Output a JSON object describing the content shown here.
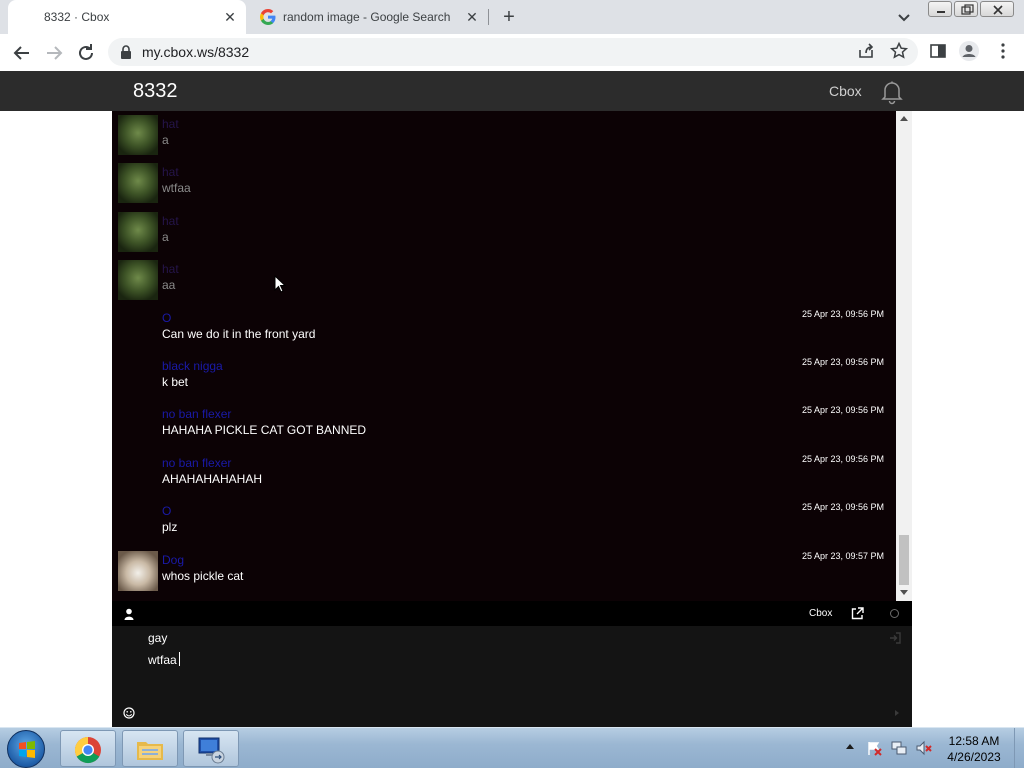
{
  "browser": {
    "tabs": [
      {
        "title": "8332 · Cbox",
        "active": true
      },
      {
        "title": "random image - Google Search",
        "active": false
      }
    ],
    "url": "my.cbox.ws/8332"
  },
  "page": {
    "title": "8332",
    "brand": "Cbox",
    "accent_name_color": "#1a1aa8",
    "chat_background": "#0c0205"
  },
  "messages": [
    {
      "name": "hat",
      "text": "a",
      "time": "",
      "avatar": "alien",
      "dim": true
    },
    {
      "name": "hat",
      "text": "wtfaa",
      "time": "",
      "avatar": "alien",
      "dim": true
    },
    {
      "name": "hat",
      "text": "a",
      "time": "",
      "avatar": "alien",
      "dim": true
    },
    {
      "name": "hat",
      "text": "aa",
      "time": "",
      "avatar": "alien",
      "dim": true
    },
    {
      "name": "O",
      "text": "Can we do it in the front yard",
      "time": "25 Apr 23, 09:56 PM",
      "avatar": "",
      "dim": false
    },
    {
      "name": "black nigga",
      "text": "k bet",
      "time": "25 Apr 23, 09:56 PM",
      "avatar": "",
      "dim": false
    },
    {
      "name": "no ban flexer",
      "text": "HAHAHA PICKLE CAT GOT BANNED",
      "time": "25 Apr 23, 09:56 PM",
      "avatar": "",
      "dim": false
    },
    {
      "name": "no ban flexer",
      "text": "AHAHAHAHAHAH",
      "time": "25 Apr 23, 09:56 PM",
      "avatar": "",
      "dim": false
    },
    {
      "name": "O",
      "text": "plz",
      "time": "25 Apr 23, 09:56 PM",
      "avatar": "",
      "dim": false
    },
    {
      "name": "Dog",
      "text": "whos pickle cat",
      "time": "25 Apr 23, 09:57 PM",
      "avatar": "dog",
      "dim": false
    }
  ],
  "chat_toolbar": {
    "brand": "Cbox"
  },
  "input": {
    "lines": [
      "gay",
      "wtfaa"
    ]
  },
  "taskbar": {
    "time": "12:58 AM",
    "date": "4/26/2023",
    "apps": [
      "chrome-icon",
      "explorer-icon",
      "network-icon"
    ]
  }
}
